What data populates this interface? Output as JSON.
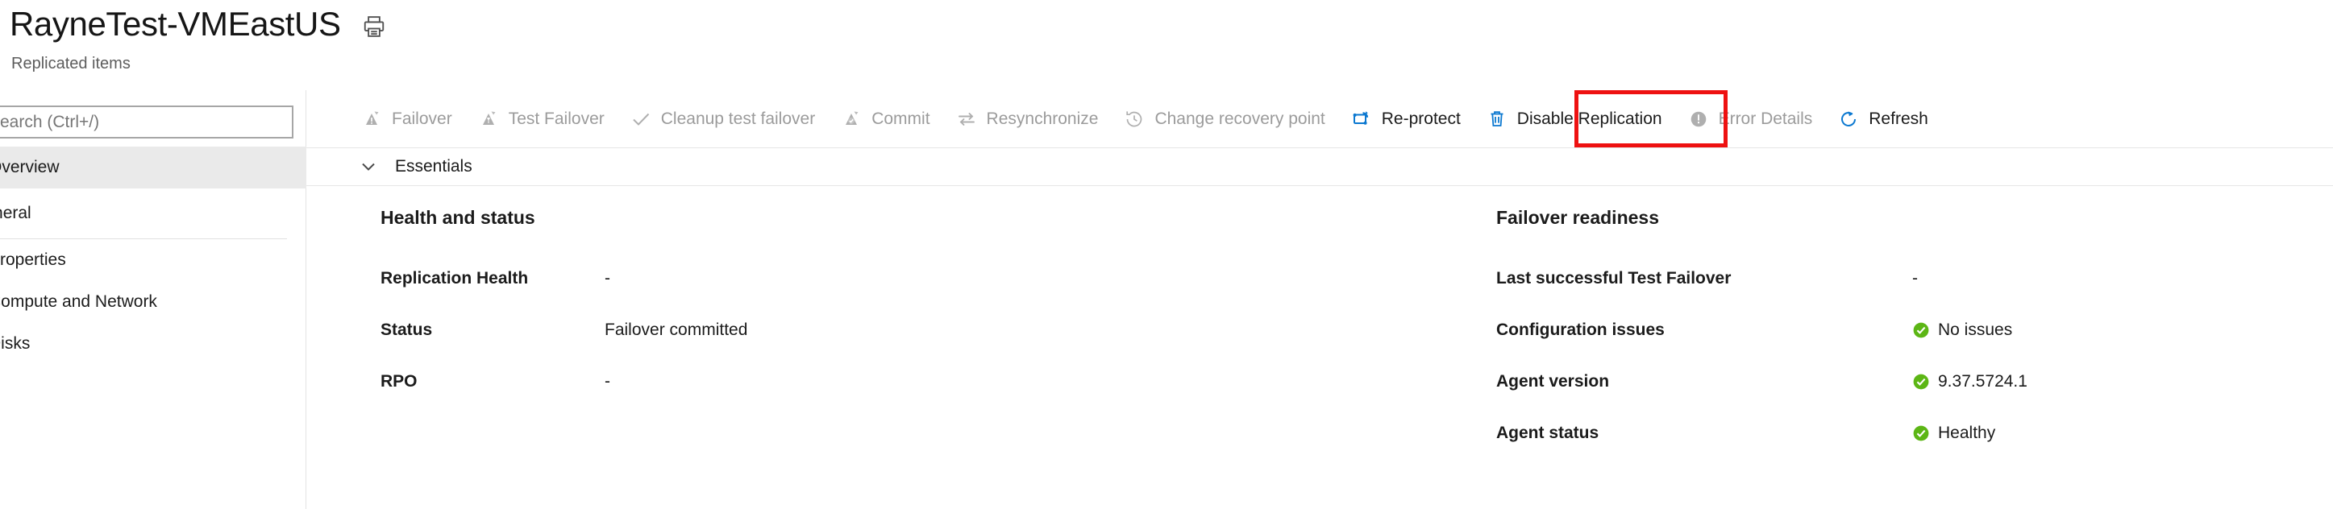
{
  "header": {
    "title": "RayneTest-VMEastUS",
    "subtitle": "Replicated items",
    "print_icon": "print-icon"
  },
  "sidebar": {
    "search": {
      "placeholder": "Search (Ctrl+/)",
      "value": ""
    },
    "collapse_label": "«",
    "items": [
      {
        "label": "Overview",
        "type": "item",
        "selected": true
      },
      {
        "label": "General",
        "type": "group",
        "selected": false
      },
      {
        "label": "Properties",
        "type": "item",
        "selected": false
      },
      {
        "label": "Compute and Network",
        "type": "item",
        "selected": false
      },
      {
        "label": "Disks",
        "type": "item",
        "selected": false
      }
    ]
  },
  "toolbar": {
    "commands": [
      {
        "label": "Failover",
        "icon": "failover-icon",
        "enabled": false,
        "annotated": false
      },
      {
        "label": "Test Failover",
        "icon": "test-failover-icon",
        "enabled": false,
        "annotated": false
      },
      {
        "label": "Cleanup test failover",
        "icon": "checkmark-icon",
        "enabled": false,
        "annotated": false
      },
      {
        "label": "Commit",
        "icon": "commit-icon",
        "enabled": false,
        "annotated": false
      },
      {
        "label": "Resynchronize",
        "icon": "resynchronize-icon",
        "enabled": false,
        "annotated": false
      },
      {
        "label": "Change recovery point",
        "icon": "clock-history-icon",
        "enabled": false,
        "annotated": false
      },
      {
        "label": "Re-protect",
        "icon": "re-protect-icon",
        "enabled": true,
        "annotated": true
      },
      {
        "label": "Disable Replication",
        "icon": "trash-icon",
        "enabled": true,
        "annotated": false
      },
      {
        "label": "Error Details",
        "icon": "error-icon",
        "enabled": false,
        "annotated": false
      },
      {
        "label": "Refresh",
        "icon": "refresh-icon",
        "enabled": true,
        "annotated": false
      }
    ],
    "annotation_color": "#ee1111"
  },
  "essentials": {
    "label": "Essentials",
    "chevron_icon": "chevron-down-icon",
    "expanded": true
  },
  "health_and_status": {
    "title": "Health and status",
    "rows": [
      {
        "key": "Replication Health",
        "value": "-",
        "status": "none"
      },
      {
        "key": "Status",
        "value": "Failover committed",
        "status": "none"
      },
      {
        "key": "RPO",
        "value": "-",
        "status": "none"
      }
    ]
  },
  "failover_readiness": {
    "title": "Failover readiness",
    "rows": [
      {
        "key": "Last successful Test Failover",
        "value": "-",
        "status": "none"
      },
      {
        "key": "Configuration issues",
        "value": "No issues",
        "status": "ok"
      },
      {
        "key": "Agent version",
        "value": "9.37.5724.1",
        "status": "ok"
      },
      {
        "key": "Agent status",
        "value": "Healthy",
        "status": "ok"
      }
    ]
  },
  "colors": {
    "accent_blue": "#0078d4",
    "ok_green": "#5cb615",
    "annotation_red": "#ee1111",
    "disabled_gray": "#9b9b9b"
  }
}
